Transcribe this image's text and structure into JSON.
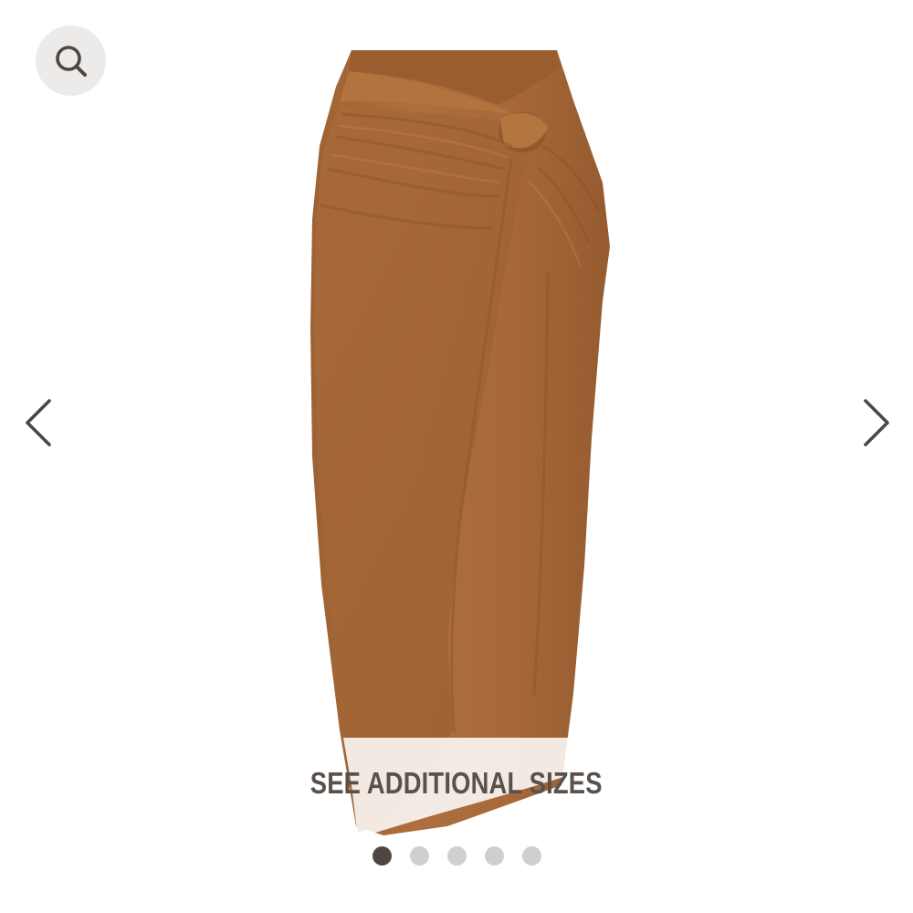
{
  "gallery": {
    "banner": {
      "label": "SEE ADDITIONAL SIZES"
    },
    "pagination": {
      "count": 5,
      "active_index": 0
    },
    "icons": {
      "search": "search-icon",
      "prev": "chevron-left-icon",
      "next": "chevron-right-icon"
    }
  },
  "colors": {
    "skirt": "#a86a3b",
    "icon": "#4e4642",
    "banner_text": "#5a514c",
    "search_bg": "#ecebe9",
    "dot_active": "#4e4642",
    "dot_inactive": "#cfcfcf"
  }
}
